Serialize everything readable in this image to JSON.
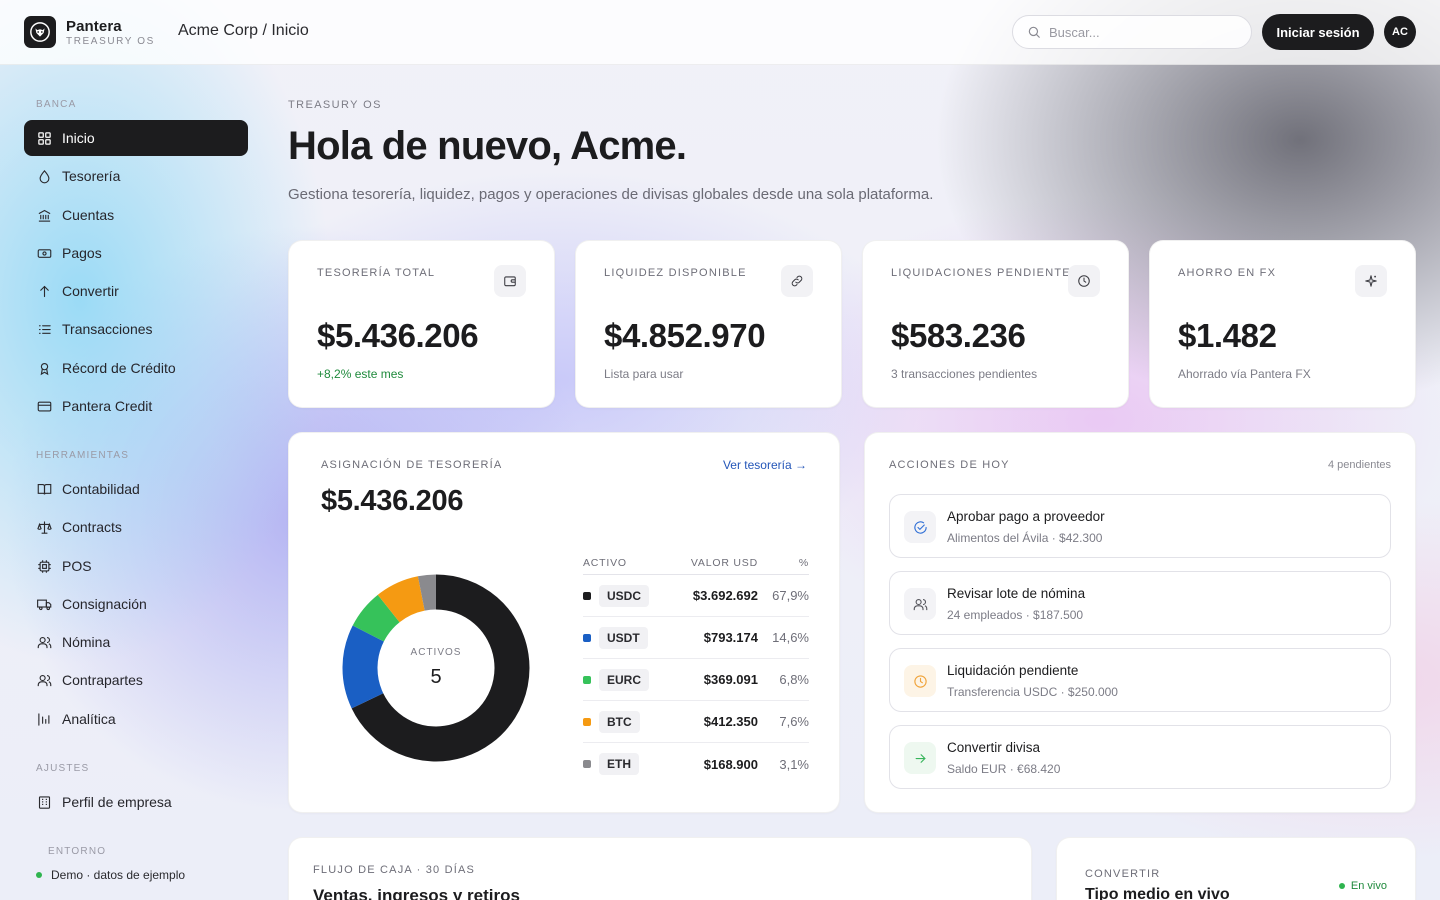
{
  "brand": {
    "name": "Pantera",
    "sub": "TREASURY OS"
  },
  "breadcrumb": "Acme Corp / Inicio",
  "search": {
    "placeholder": "Buscar..."
  },
  "header": {
    "login_label": "Iniciar sesión",
    "avatar_initials": "AC"
  },
  "sidebar": {
    "banca_label": "BANCA",
    "banca_items": [
      {
        "label": "Inicio",
        "icon": "grid-icon",
        "active": true
      },
      {
        "label": "Tesorería",
        "icon": "drop-icon"
      },
      {
        "label": "Cuentas",
        "icon": "bank-icon"
      },
      {
        "label": "Pagos",
        "icon": "banknote-icon"
      },
      {
        "label": "Convertir",
        "icon": "arrow-up-icon"
      },
      {
        "label": "Transacciones",
        "icon": "list-icon"
      },
      {
        "label": "Récord de Crédito",
        "icon": "award-icon"
      },
      {
        "label": "Pantera Credit",
        "icon": "credit-card-icon"
      }
    ],
    "tools_label": "HERRAMIENTAS",
    "tools_items": [
      {
        "label": "Contabilidad",
        "icon": "book-icon"
      },
      {
        "label": "Contracts",
        "icon": "scale-icon"
      },
      {
        "label": "POS",
        "icon": "chip-icon"
      },
      {
        "label": "Consignación",
        "icon": "truck-icon"
      },
      {
        "label": "Nómina",
        "icon": "users-icon"
      },
      {
        "label": "Contrapartes",
        "icon": "users-icon"
      },
      {
        "label": "Analítica",
        "icon": "bar-chart-icon"
      }
    ],
    "settings_label": "AJUSTES",
    "settings_items": [
      {
        "label": "Perfil de empresa",
        "icon": "building-icon"
      }
    ],
    "env_label": "ENTORNO",
    "env_value": "Demo · datos de ejemplo"
  },
  "main": {
    "eyebrow": "TREASURY OS",
    "greeting": "Hola de nuevo, Acme.",
    "subtitle": "Gestiona tesorería, liquidez, pagos y operaciones de divisas globales desde una sola plataforma."
  },
  "stats": [
    {
      "label": "TESORERÍA TOTAL",
      "value": "$5.436.206",
      "note": "+8,2% este mes",
      "icon": "wallet-icon"
    },
    {
      "label": "LIQUIDEZ DISPONIBLE",
      "value": "$4.852.970",
      "note": "Lista para usar",
      "icon": "link-icon"
    },
    {
      "label": "LIQUIDACIONES PENDIENTES",
      "value": "$583.236",
      "note": "3 transacciones pendientes",
      "icon": "clock-icon"
    },
    {
      "label": "AHORRO EN FX",
      "value": "$1.482",
      "note": "Ahorrado vía Pantera FX",
      "icon": "sparkle-icon"
    }
  ],
  "allocation": {
    "title": "ASIGNACIÓN DE TESORERÍA",
    "link": "Ver tesorería →",
    "total": "$5.436.206",
    "center_label": "ACTIVOS",
    "center_value": "5",
    "columns": [
      "ACTIVO",
      "VALOR USD",
      "%"
    ],
    "rows": [
      {
        "asset": "USDC",
        "value": "$3.692.692",
        "pct": "67,9%",
        "share": 67.9,
        "color": "#1c1c1e"
      },
      {
        "asset": "USDT",
        "value": "$793.174",
        "pct": "14,6%",
        "share": 14.6,
        "color": "#1a5fc4"
      },
      {
        "asset": "EURC",
        "value": "$369.091",
        "pct": "6,8%",
        "share": 6.8,
        "color": "#36c25a"
      },
      {
        "asset": "BTC",
        "value": "$412.350",
        "pct": "7,6%",
        "share": 7.6,
        "color": "#f59a12"
      },
      {
        "asset": "ETH",
        "value": "$168.900",
        "pct": "3,1%",
        "share": 3.1,
        "color": "#8a8a8e"
      }
    ]
  },
  "actions": {
    "title": "ACCIONES DE HOY",
    "count": "4 pendientes",
    "items": [
      {
        "title": "Aprobar pago a proveedor",
        "sub": "Alimentos del Ávila · $42.300",
        "icon": "check-circle-icon",
        "color": "#2f6fd6"
      },
      {
        "title": "Revisar lote de nómina",
        "sub": "24 empleados · $187.500",
        "icon": "users-icon",
        "color": "#55555c"
      },
      {
        "title": "Liquidación pendiente",
        "sub": "Transferencia USDC · $250.000",
        "icon": "clock-icon",
        "color": "#f0a33a"
      },
      {
        "title": "Convertir divisa",
        "sub": "Saldo EUR · €68.420",
        "icon": "arrow-right-icon",
        "color": "#36b45a"
      }
    ]
  },
  "cashflow": {
    "eyebrow": "FLUJO DE CAJA · 30 DÍAS",
    "title": "Ventas, ingresos y retiros"
  },
  "convert": {
    "eyebrow": "CONVERTIR",
    "title": "Tipo medio en vivo",
    "live": "En vivo"
  }
}
